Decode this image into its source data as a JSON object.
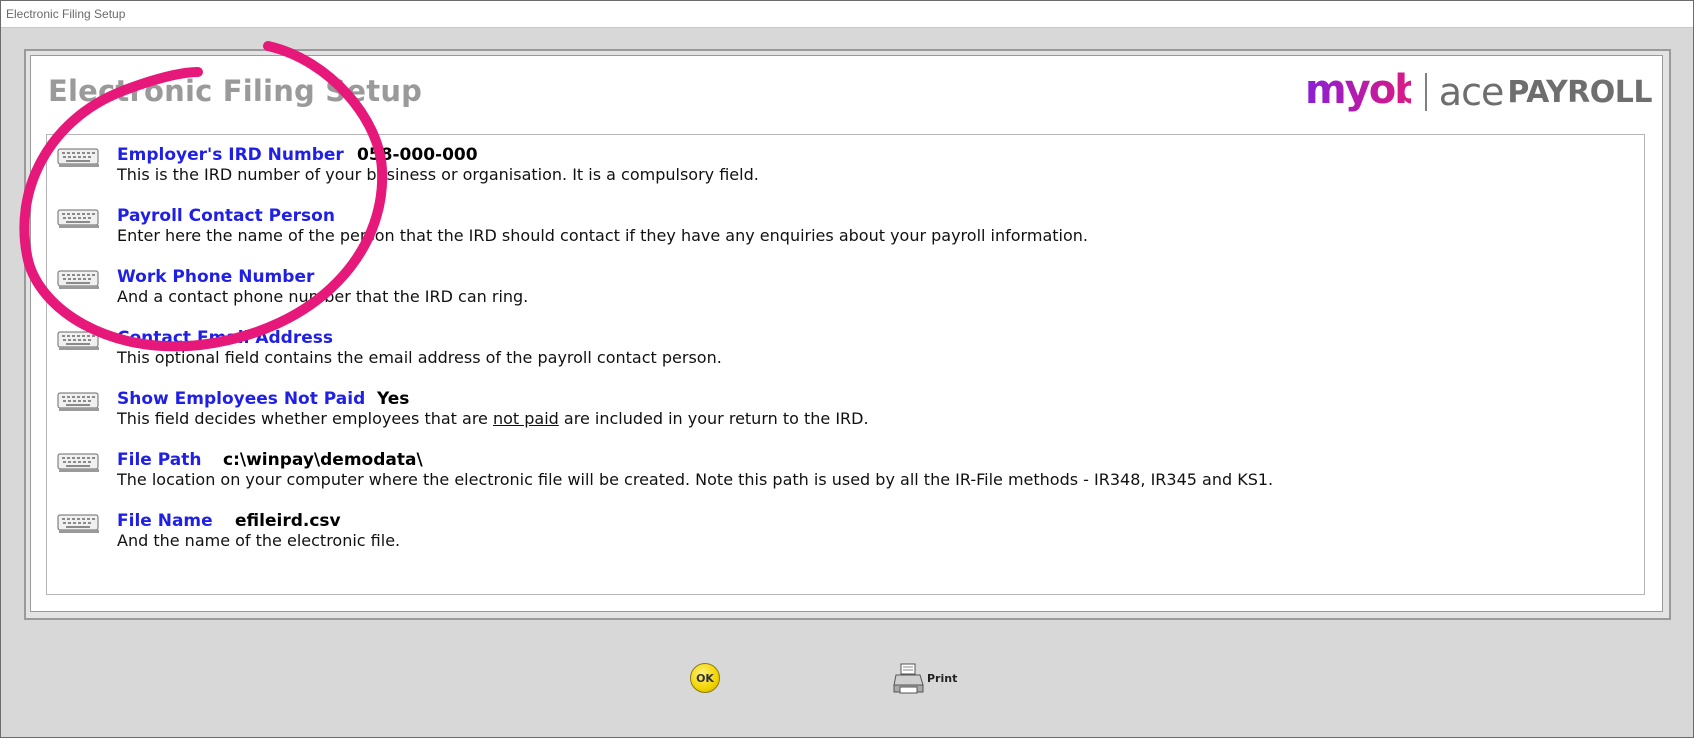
{
  "window": {
    "title": "Electronic Filing Setup"
  },
  "page": {
    "heading": "Electronic Filing Setup"
  },
  "logo": {
    "myob": "myob",
    "ace": "ace",
    "payroll": "PAYROLL",
    "colors": {
      "myob_start": "#8a1fd6",
      "myob_end": "#e4197b",
      "ace": "#6e6e6e"
    }
  },
  "fields": [
    {
      "label": "Employer's IRD Number",
      "value": "058-000-000",
      "description": "This is the IRD number of your business or organisation. It is a compulsory field."
    },
    {
      "label": "Payroll Contact Person",
      "value": "",
      "description": "Enter here the name of the person that the IRD should contact if they have any enquiries about your payroll information."
    },
    {
      "label": "Work Phone Number",
      "value": "",
      "description": "And a contact phone number that the IRD can ring."
    },
    {
      "label": "Contact Email Address",
      "value": "",
      "description": "This optional field contains the email address of the payroll contact person."
    },
    {
      "label": "Show Employees Not Paid",
      "value": "Yes",
      "description_pre": "This field decides whether employees that are ",
      "description_underline": "not paid",
      "description_post": " are included in your return to the IRD."
    },
    {
      "label": "File Path",
      "value": "c:\\winpay\\demodata\\",
      "description": "The location on your computer where the electronic file will be created. Note this path is used by all the IR-File methods - IR348, IR345 and KS1."
    },
    {
      "label": "File Name",
      "value": "efileird.csv",
      "description": "And the name of the electronic file."
    }
  ],
  "buttons": {
    "ok": "OK",
    "print": "Print"
  },
  "colors": {
    "label": "#1f1fe6",
    "annotation": "#e6187a",
    "heading": "#9a9a9a"
  },
  "icons": {
    "field": "keyboard-icon",
    "print": "printer-icon"
  }
}
